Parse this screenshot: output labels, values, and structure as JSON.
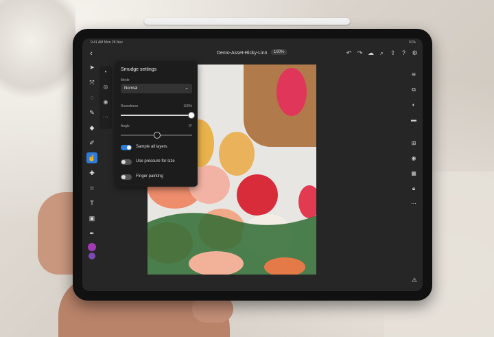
{
  "status": {
    "time": "9:41 AM",
    "date": "Mon 28 Nov",
    "battery": "91%"
  },
  "header": {
    "back_icon": "chevron-left-icon",
    "doc_title": "Demo-Asset-Ricky-Linn",
    "zoom": "100%",
    "icons": [
      "undo-icon",
      "redo-icon",
      "cloud-icon",
      "search-icon",
      "share-icon",
      "help-icon",
      "settings-icon"
    ]
  },
  "tools": [
    "move-icon",
    "transform-icon",
    "lasso-icon",
    "brush-icon",
    "fill-icon",
    "eraser-icon",
    "smudge-icon",
    "clone-icon",
    "crop-icon",
    "text-icon",
    "image-icon",
    "eyedropper-icon"
  ],
  "colors": {
    "primary": "#a13bb3",
    "secondary": "#7b4ab0",
    "accent": "#2d7bdb"
  },
  "smudge_panel": {
    "title": "Smudge settings",
    "mode_label": "Mode",
    "mode_value": "Normal",
    "roundness_label": "Roundness",
    "roundness_value": "100%",
    "angle_label": "Angle",
    "angle_value": "0°",
    "toggles": [
      {
        "label": "Sample all layers",
        "on": true
      },
      {
        "label": "Use pressure for size",
        "on": false
      },
      {
        "label": "Finger painting",
        "on": false
      }
    ]
  },
  "right_icons": [
    "layers-icon",
    "adjust-icon",
    "mask-icon",
    "comment-icon",
    "add-layer-icon",
    "visibility-icon",
    "layer-properties-icon",
    "lock-icon",
    "more-icon"
  ]
}
